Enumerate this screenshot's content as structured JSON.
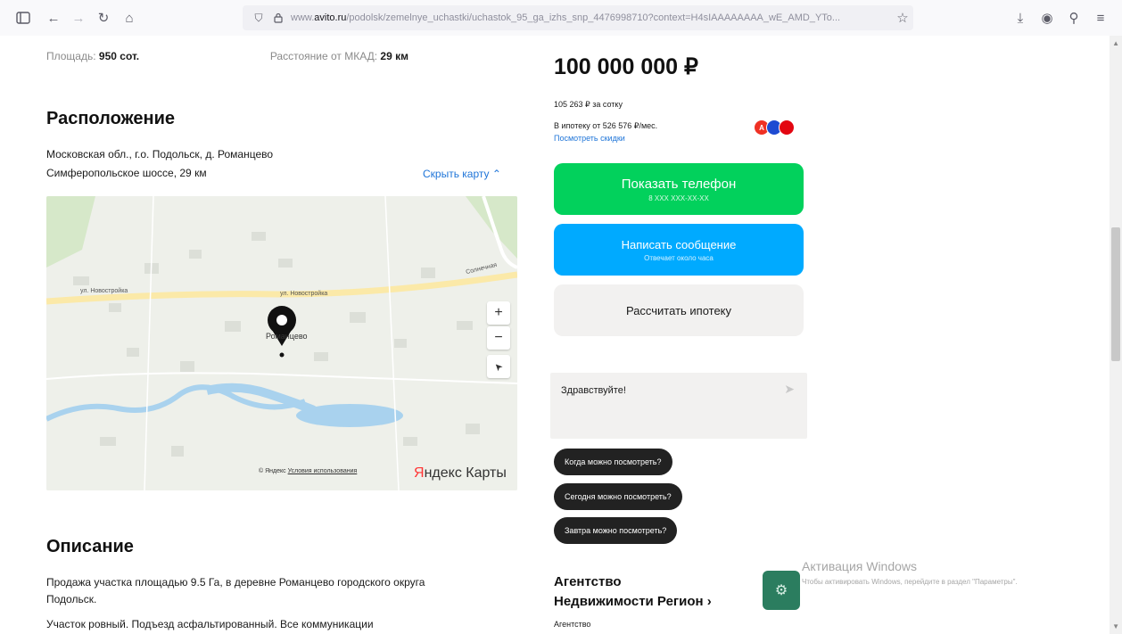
{
  "browser": {
    "url_prefix": "www.",
    "url_domain": "avito.ru",
    "url_path": "/podolsk/zemelnye_uchastki/uchastok_95_ga_izhs_snp_4476998710?context=H4sIAAAAAAAA_wE_AMD_YTo...",
    "icons": [
      "sidebar-icon",
      "back-icon",
      "forward-icon",
      "reload-icon",
      "home-icon",
      "shield-icon",
      "lock-icon",
      "bookmark-star-icon",
      "download-icon",
      "account-icon",
      "extensions-icon",
      "menu-icon"
    ]
  },
  "params": {
    "area_label": "Площадь:",
    "area_value": "950 сот.",
    "distance_label": "Расстояние от МКАД:",
    "distance_value": "29 км"
  },
  "location": {
    "heading": "Расположение",
    "address_line1": "Московская обл., г.о. Подольск, д. Романцево",
    "address_line2": "Симферопольское шоссе, 29 км",
    "hide_map": "Скрыть карту ⌃"
  },
  "map": {
    "road_label_1": "ул. Новостройка",
    "road_label_2": "ул. Новостройка",
    "road_label_3": "Солнечная",
    "place_label": "Романцево",
    "zoom_in": "+",
    "zoom_out": "−",
    "locate": "➤",
    "footer_prefix": "© Яндекс",
    "footer_terms": "Условия использования",
    "brand_y": "Я",
    "brand_rest": "ндекс Карты"
  },
  "description": {
    "heading": "Описание",
    "line1": "Продажа участка площадью 9.5 Га, в деревне Романцево городского округа",
    "line2": "Подольск.",
    "line3": "Участок ровный. Подъезд асфальтированный. Все коммуникации"
  },
  "price": {
    "value": "100 000 000 ₽",
    "per_sotka": "105 263 ₽ за сотку",
    "mortgage": "В ипотеку от 526 576 ₽/мес.",
    "discounts": "Посмотреть скидки"
  },
  "buttons": {
    "show_phone": "Показать телефон",
    "phone_masked": "8 XXX XXX-XX-XX",
    "write_message": "Написать сообщение",
    "reply_time": "Отвечает около часа",
    "calc_mortgage": "Рассчитать ипотеку"
  },
  "chat": {
    "greeting": "Здравствуйте!",
    "send_icon": "➤"
  },
  "quick_replies": [
    "Когда можно посмотреть?",
    "Сегодня можно посмотреть?",
    "Завтра можно посмотреть?"
  ],
  "agency": {
    "name_line1": "Агентство",
    "name_line2": "Недвижимости Регион ›",
    "type": "Агентство"
  },
  "watermark": {
    "title": "Активация Windows",
    "text": "Чтобы активировать Windows, перейдите в раздел \"Параметры\"."
  },
  "colors": {
    "green": "#02d15c",
    "blue": "#00aaff",
    "link": "#1e74d8"
  }
}
